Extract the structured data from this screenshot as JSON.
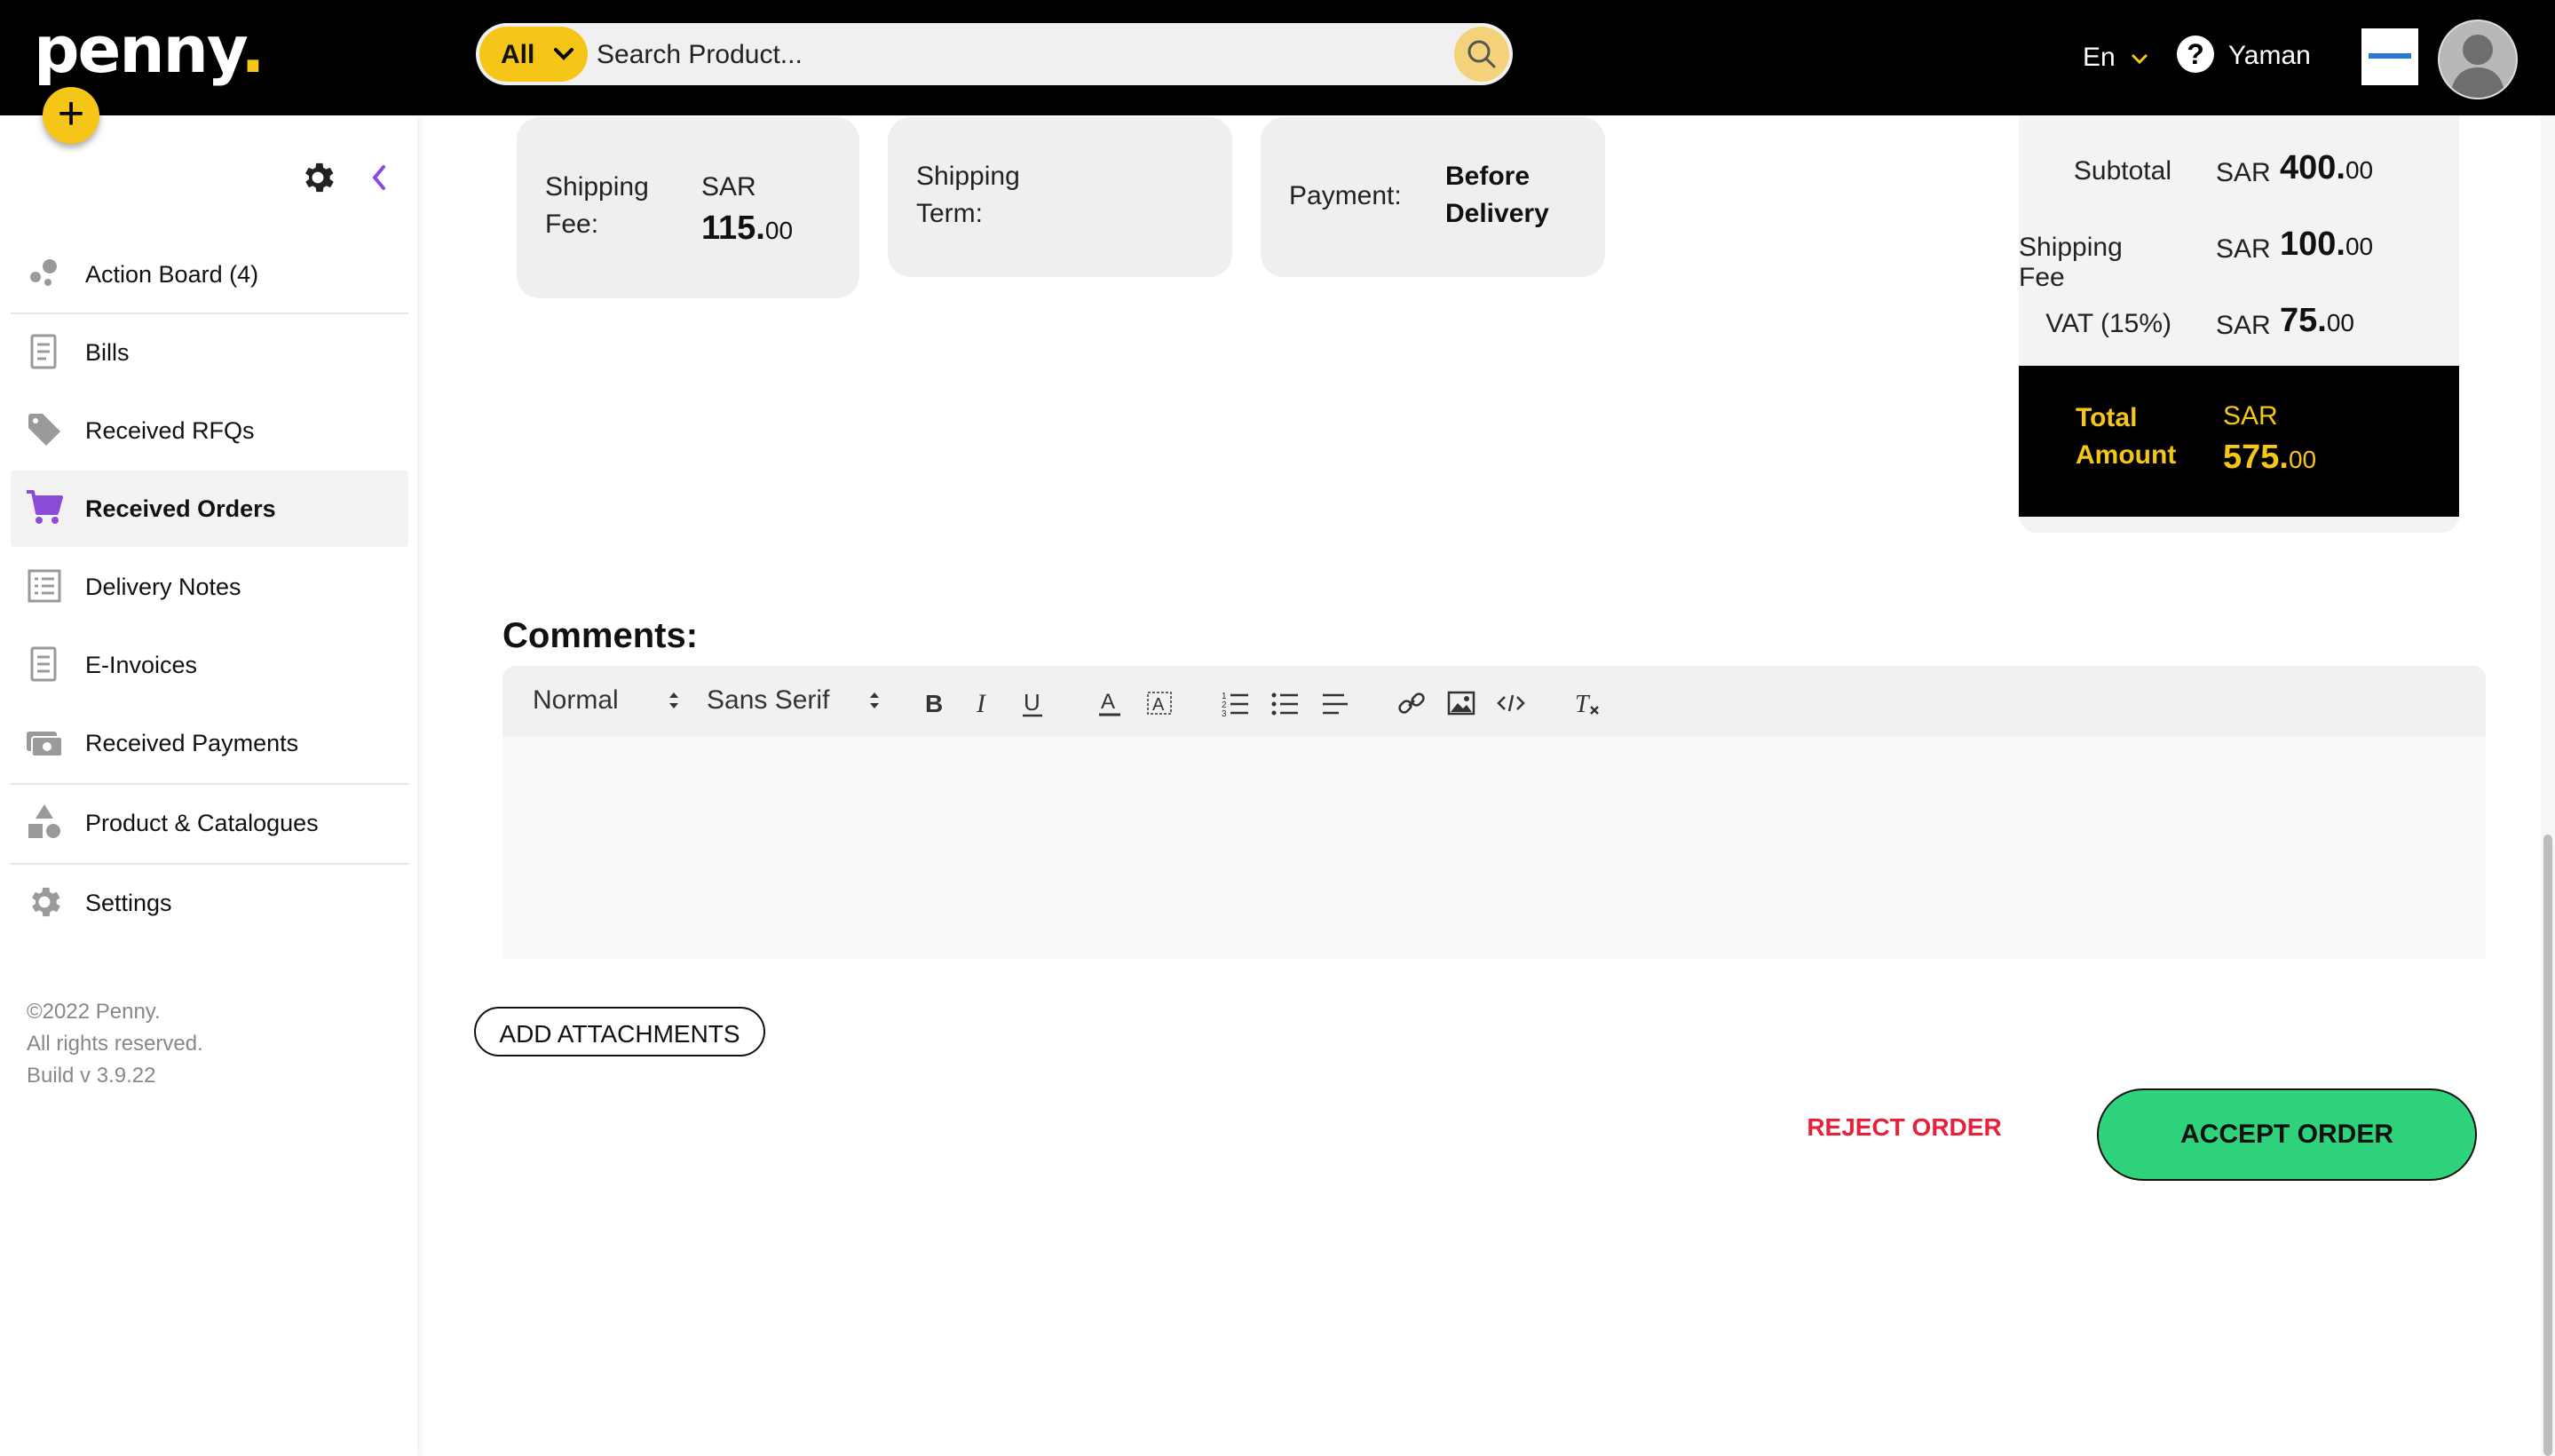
{
  "header": {
    "logo_text": "penny",
    "logo_dot": ".",
    "add_label": "+",
    "search": {
      "category": "All",
      "placeholder": "Search Product..."
    },
    "language": "En",
    "help_label": "?",
    "user_name": "Yaman"
  },
  "sidebar": {
    "items": [
      {
        "label": "Action Board (4)",
        "icon": "bubbles-icon"
      },
      {
        "label": "Bills",
        "icon": "receipt-icon"
      },
      {
        "label": "Received RFQs",
        "icon": "tag-icon"
      },
      {
        "label": "Received Orders",
        "icon": "cart-icon",
        "active": true
      },
      {
        "label": "Delivery Notes",
        "icon": "list-icon"
      },
      {
        "label": "E-Invoices",
        "icon": "invoice-icon"
      },
      {
        "label": "Received Payments",
        "icon": "cash-icon"
      },
      {
        "label": "Product & Catalogues",
        "icon": "shapes-icon"
      },
      {
        "label": "Settings",
        "icon": "gear-icon"
      }
    ],
    "copyright": [
      "©2022 Penny.",
      "All rights reserved.",
      "Build v 3.9.22"
    ]
  },
  "order_info": {
    "shipping_fee_label_1": "Shipping",
    "shipping_fee_label_2": "Fee:",
    "shipping_fee_currency": "SAR",
    "shipping_fee_int": "115.",
    "shipping_fee_dec": "00",
    "shipping_term_label_1": "Shipping",
    "shipping_term_label_2": "Term:",
    "payment_label": "Payment:",
    "payment_value_1": "Before",
    "payment_value_2": "Delivery"
  },
  "summary": {
    "subtotal": {
      "label": "Subtotal",
      "currency": "SAR",
      "int": "400.",
      "dec": "00"
    },
    "shipping": {
      "label": "Shipping Fee",
      "currency": "SAR",
      "int": "100.",
      "dec": "00"
    },
    "vat": {
      "label": "VAT (15%)",
      "currency": "SAR",
      "int": "75.",
      "dec": "00"
    },
    "total": {
      "label_1": "Total",
      "label_2": "Amount",
      "currency": "SAR",
      "int": "575.",
      "dec": "00"
    }
  },
  "comments": {
    "title": "Comments:",
    "format_select": "Normal",
    "font_select": "Sans Serif"
  },
  "actions": {
    "add_attachments": "ADD ATTACHMENTS",
    "reject": "REJECT ORDER",
    "accept": "ACCEPT ORDER"
  },
  "colors": {
    "brand_yellow": "#f5c518",
    "accent_purple": "#8a4bd6",
    "accept_green": "#2ed37c",
    "reject_red": "#e8203c"
  }
}
